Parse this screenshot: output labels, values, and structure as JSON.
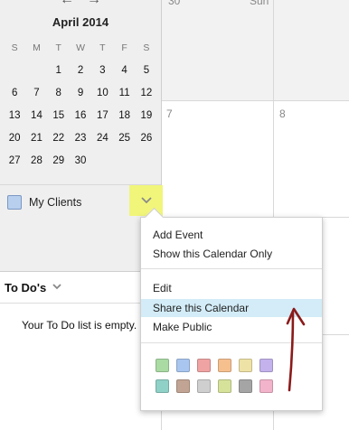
{
  "mini_calendar": {
    "month_label": "April 2014",
    "weekday_headers": [
      "S",
      "M",
      "T",
      "W",
      "T",
      "F",
      "S"
    ],
    "weeks": [
      [
        "",
        "",
        "1",
        "2",
        "3",
        "4",
        "5"
      ],
      [
        "6",
        "7",
        "8",
        "9",
        "10",
        "11",
        "12"
      ],
      [
        "13",
        "14",
        "15",
        "16",
        "17",
        "18",
        "19"
      ],
      [
        "20",
        "21",
        "22",
        "23",
        "24",
        "25",
        "26"
      ],
      [
        "27",
        "28",
        "29",
        "30",
        "",
        "",
        ""
      ]
    ]
  },
  "calendars": {
    "item_label": "My Clients",
    "swatch_color": "#b8cfee",
    "highlight_color": "#f1f57a"
  },
  "todo": {
    "title": "To Do's",
    "empty_message": "Your To Do list is empty."
  },
  "main_grid": {
    "day_top_left": "30",
    "day_top_right": "Sun",
    "day_left": "7",
    "day_right": "8"
  },
  "context_menu": {
    "items": [
      {
        "label": "Add Event"
      },
      {
        "label": "Show this Calendar Only"
      },
      {
        "label": "Edit"
      },
      {
        "label": "Share this Calendar"
      },
      {
        "label": "Make Public"
      }
    ],
    "highlighted_item": "Share this Calendar",
    "color_rows": [
      [
        "#a9dba3",
        "#a9c6f0",
        "#f0a3a3",
        "#f6c08e",
        "#efe2a6",
        "#c3b2ec"
      ],
      [
        "#8fd1c7",
        "#c1a493",
        "#cfcfcf",
        "#d6e29a",
        "#a5a5a5",
        "#f2b4cb"
      ]
    ]
  },
  "annotation": {
    "color": "#8b1a1a"
  }
}
